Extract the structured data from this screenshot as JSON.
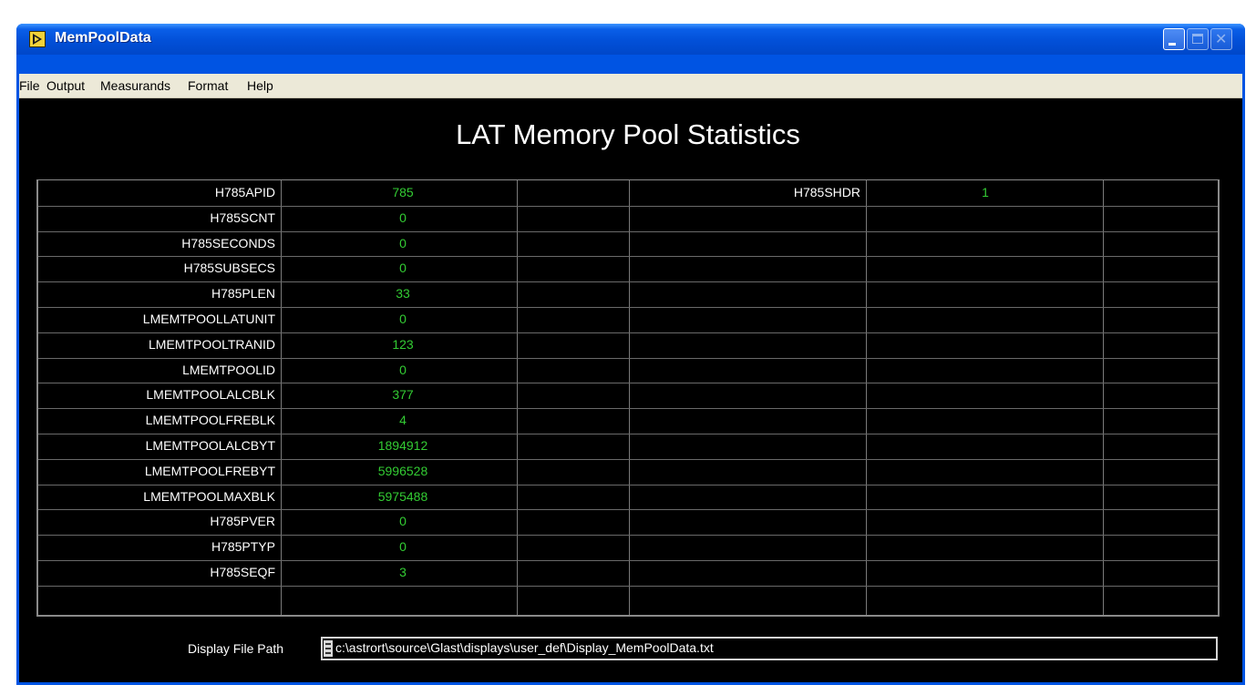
{
  "window": {
    "title": "MemPoolData",
    "icon": "labview-run-icon",
    "controls": [
      "minimize-icon",
      "maximize-icon",
      "close-icon"
    ]
  },
  "menu": [
    "File",
    "Output",
    "Measurands",
    "Format",
    "Help"
  ],
  "panel": {
    "title": "LAT Memory Pool Statistics"
  },
  "table": {
    "left_rows": [
      {
        "label": "H785APID",
        "value": "785"
      },
      {
        "label": "H785SCNT",
        "value": "0"
      },
      {
        "label": "H785SECONDS",
        "value": "0"
      },
      {
        "label": "H785SUBSECS",
        "value": "0"
      },
      {
        "label": "H785PLEN",
        "value": "33"
      },
      {
        "label": "LMEMTPOOLLATUNIT",
        "value": "0"
      },
      {
        "label": "LMEMTPOOLTRANID",
        "value": "123"
      },
      {
        "label": "LMEMTPOOLID",
        "value": "0"
      },
      {
        "label": "LMEMTPOOLALCBLK",
        "value": "377"
      },
      {
        "label": "LMEMTPOOLFREBLK",
        "value": "4"
      },
      {
        "label": "LMEMTPOOLALCBYT",
        "value": "1894912"
      },
      {
        "label": "LMEMTPOOLFREBYT",
        "value": "5996528"
      },
      {
        "label": "LMEMTPOOLMAXBLK",
        "value": "5975488"
      },
      {
        "label": "H785PVER",
        "value": "0"
      },
      {
        "label": "H785PTYP",
        "value": "0"
      },
      {
        "label": "H785SEQF",
        "value": "3"
      }
    ],
    "right_rows": [
      {
        "label": "H785SHDR",
        "value": "1"
      }
    ]
  },
  "path": {
    "label": "Display File Path",
    "value": "c:\\astrort\\source\\Glast\\displays\\user_def\\Display_MemPoolData.txt"
  },
  "colors": {
    "value_text": "#33cc33",
    "background": "#000000",
    "titlebar": "#0054e3"
  }
}
